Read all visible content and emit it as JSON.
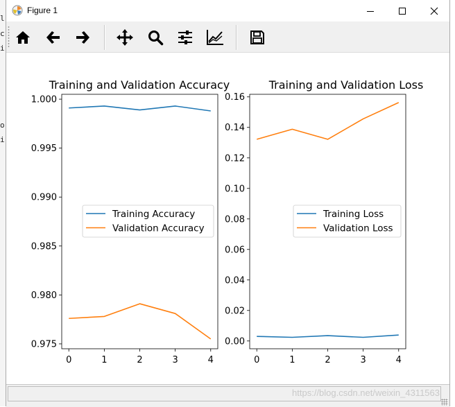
{
  "window": {
    "title": "Figure 1"
  },
  "background_text": [
    "l",
    "c",
    "i",
    "o",
    "i"
  ],
  "toolbar": {
    "buttons": [
      {
        "name": "home-button",
        "icon": "home-icon"
      },
      {
        "name": "back-button",
        "icon": "arrow-left-icon"
      },
      {
        "name": "forward-button",
        "icon": "arrow-right-icon"
      },
      {
        "name": "pan-button",
        "icon": "move-icon"
      },
      {
        "name": "zoom-button",
        "icon": "magnifier-icon"
      },
      {
        "name": "subplots-button",
        "icon": "sliders-icon"
      },
      {
        "name": "axes-edit-button",
        "icon": "line-chart-icon"
      },
      {
        "name": "save-button",
        "icon": "floppy-disk-icon"
      }
    ]
  },
  "status": {
    "watermark": "https://blog.csdn.net/weixin_4311563"
  },
  "colors": {
    "training": "#1f77b4",
    "validation": "#ff7f0e"
  },
  "chart_data": [
    {
      "type": "line",
      "title": "Training and Validation Accuracy",
      "xlabel": "",
      "ylabel": "",
      "x": [
        0,
        1,
        2,
        3,
        4
      ],
      "xticks": [
        "0",
        "1",
        "2",
        "3",
        "4"
      ],
      "yticks": [
        "0.975",
        "0.980",
        "0.985",
        "0.990",
        "0.995",
        "1.000"
      ],
      "ylim": [
        0.9745,
        1.0005
      ],
      "xlim": [
        -0.2,
        4.2
      ],
      "legend_position": "center-right",
      "series": [
        {
          "name": "Training Accuracy",
          "color": "#1f77b4",
          "values": [
            0.9991,
            0.9993,
            0.9989,
            0.9993,
            0.9988
          ]
        },
        {
          "name": "Validation Accuracy",
          "color": "#ff7f0e",
          "values": [
            0.9776,
            0.9778,
            0.9791,
            0.9781,
            0.9755
          ]
        }
      ]
    },
    {
      "type": "line",
      "title": "Training and Validation Loss",
      "xlabel": "",
      "ylabel": "",
      "x": [
        0,
        1,
        2,
        3,
        4
      ],
      "xticks": [
        "0",
        "1",
        "2",
        "3",
        "4"
      ],
      "yticks": [
        "0.00",
        "0.02",
        "0.04",
        "0.06",
        "0.08",
        "0.10",
        "0.12",
        "0.14",
        "0.16"
      ],
      "ylim": [
        -0.0051,
        0.1617
      ],
      "xlim": [
        -0.2,
        4.2
      ],
      "legend_position": "center-right",
      "series": [
        {
          "name": "Training Loss",
          "color": "#1f77b4",
          "values": [
            0.003,
            0.0024,
            0.0035,
            0.0024,
            0.0039
          ]
        },
        {
          "name": "Validation Loss",
          "color": "#ff7f0e",
          "values": [
            0.1322,
            0.1388,
            0.1322,
            0.1456,
            0.1563
          ]
        }
      ]
    }
  ]
}
